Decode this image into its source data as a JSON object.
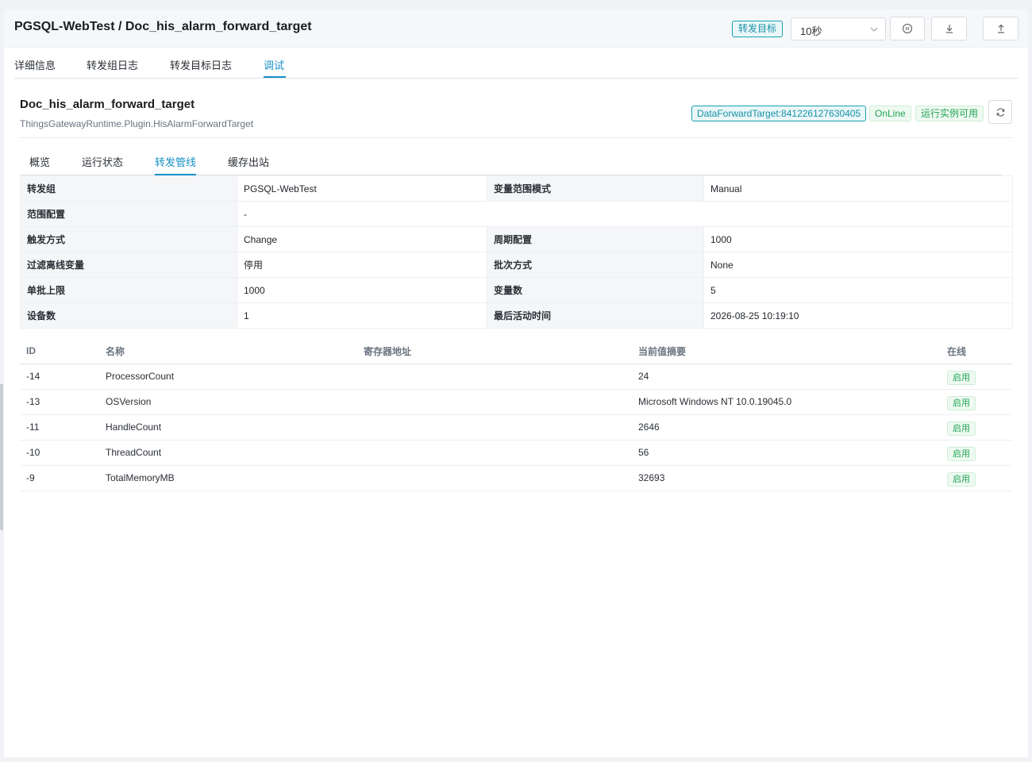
{
  "header": {
    "title": "PGSQL-WebTest / Doc_his_alarm_forward_target",
    "target_tag": "转发目标",
    "interval_select": "10秒"
  },
  "top_tabs": [
    "详细信息",
    "转发组日志",
    "转发目标日志",
    "调试"
  ],
  "target": {
    "name": "Doc_his_alarm_forward_target",
    "plugin": "ThingsGatewayRuntime.Plugin.HisAlarmForwardTarget",
    "id_badge": "DataForwardTarget:841226127630405",
    "online_badge": "OnLine",
    "ready_badge": "运行实例可用"
  },
  "sub_tabs": [
    "概览",
    "运行状态",
    "转发管线",
    "缓存出站"
  ],
  "info": {
    "row0": {
      "k1": "转发组",
      "v1": "PGSQL-WebTest",
      "k2": "变量范围模式",
      "v2": "Manual"
    },
    "row1": {
      "k1": "范围配置",
      "v1": "-"
    },
    "row2": {
      "k1": "触发方式",
      "v1": "Change",
      "k2": "周期配置",
      "v2": "1000"
    },
    "row3": {
      "k1": "过滤离线变量",
      "v1": "停用",
      "k2": "批次方式",
      "v2": "None"
    },
    "row4": {
      "k1": "单批上限",
      "v1": "1000",
      "k2": "变量数",
      "v2": "5"
    },
    "row5": {
      "k1": "设备数",
      "v1": "1",
      "k2": "最后活动时间",
      "v2": "2026-08-25 10:19:10"
    }
  },
  "variables": {
    "columns": [
      "ID",
      "名称",
      "寄存器地址",
      "当前值摘要",
      "在线"
    ],
    "rows": [
      {
        "id": "-14",
        "name": "ProcessorCount",
        "address": "",
        "value": "24",
        "online": "启用"
      },
      {
        "id": "-13",
        "name": "OSVersion",
        "address": "",
        "value": "Microsoft Windows NT 10.0.19045.0",
        "online": "启用"
      },
      {
        "id": "-11",
        "name": "HandleCount",
        "address": "",
        "value": "2646",
        "online": "启用"
      },
      {
        "id": "-10",
        "name": "ThreadCount",
        "address": "",
        "value": "56",
        "online": "启用"
      },
      {
        "id": "-9",
        "name": "TotalMemoryMB",
        "address": "",
        "value": "32693",
        "online": "启用"
      }
    ]
  },
  "colors": {
    "accent": "#1791c4",
    "tag_teal": "#1791a4",
    "status_green": "#23a455",
    "header_bg": "#f5f7f9"
  },
  "icons": {
    "select_arrow": "chevron-down-icon",
    "pause": "pause-circle-icon",
    "download": "download-icon",
    "upload": "upload-icon",
    "refresh": "refresh-icon"
  }
}
